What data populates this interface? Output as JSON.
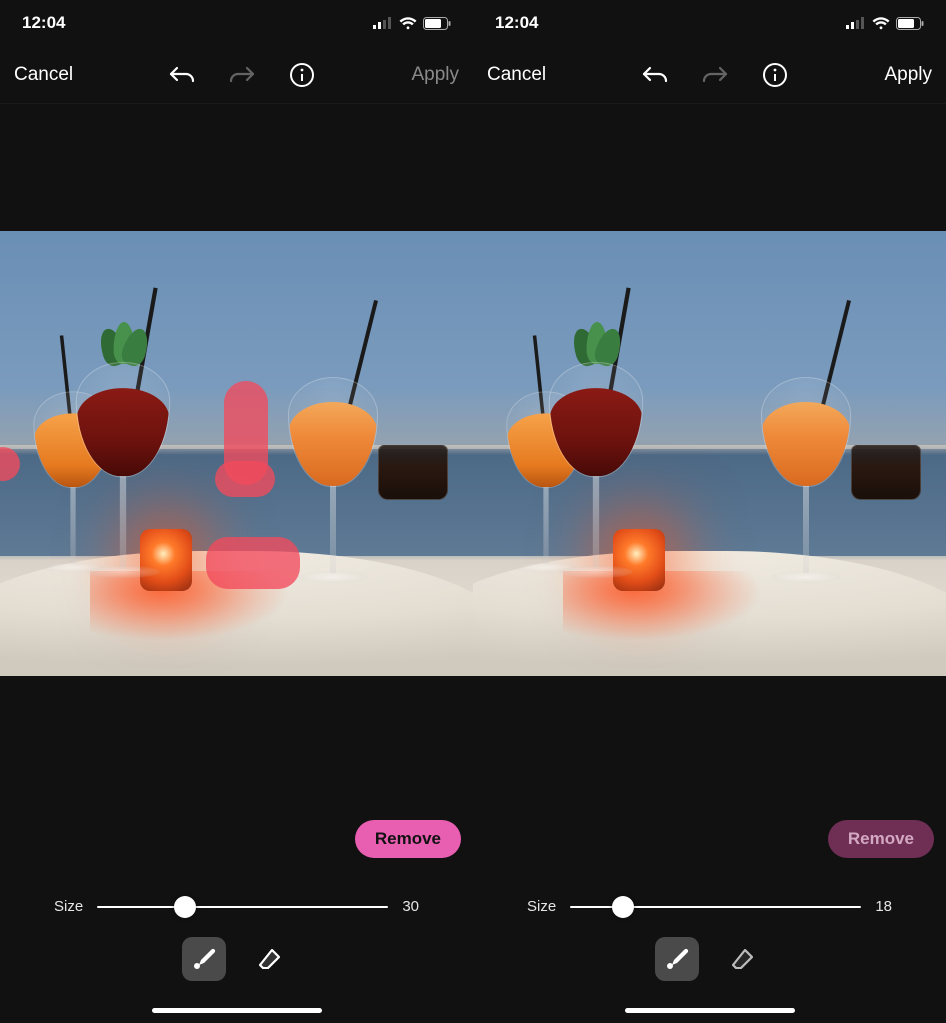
{
  "status": {
    "time": "12:04"
  },
  "panes": [
    {
      "toolbar": {
        "cancel_label": "Cancel",
        "apply_label": "Apply",
        "apply_dim": true,
        "redo_dim": true
      },
      "selection_overlays": true,
      "remove": {
        "label": "Remove",
        "active": true
      },
      "size": {
        "label": "Size",
        "value": "30",
        "percent": 30
      },
      "brush_selected": true
    },
    {
      "toolbar": {
        "cancel_label": "Cancel",
        "apply_label": "Apply",
        "apply_dim": false,
        "redo_dim": true
      },
      "selection_overlays": false,
      "remove": {
        "label": "Remove",
        "active": false
      },
      "size": {
        "label": "Size",
        "value": "18",
        "percent": 18
      },
      "brush_selected": true
    }
  ]
}
